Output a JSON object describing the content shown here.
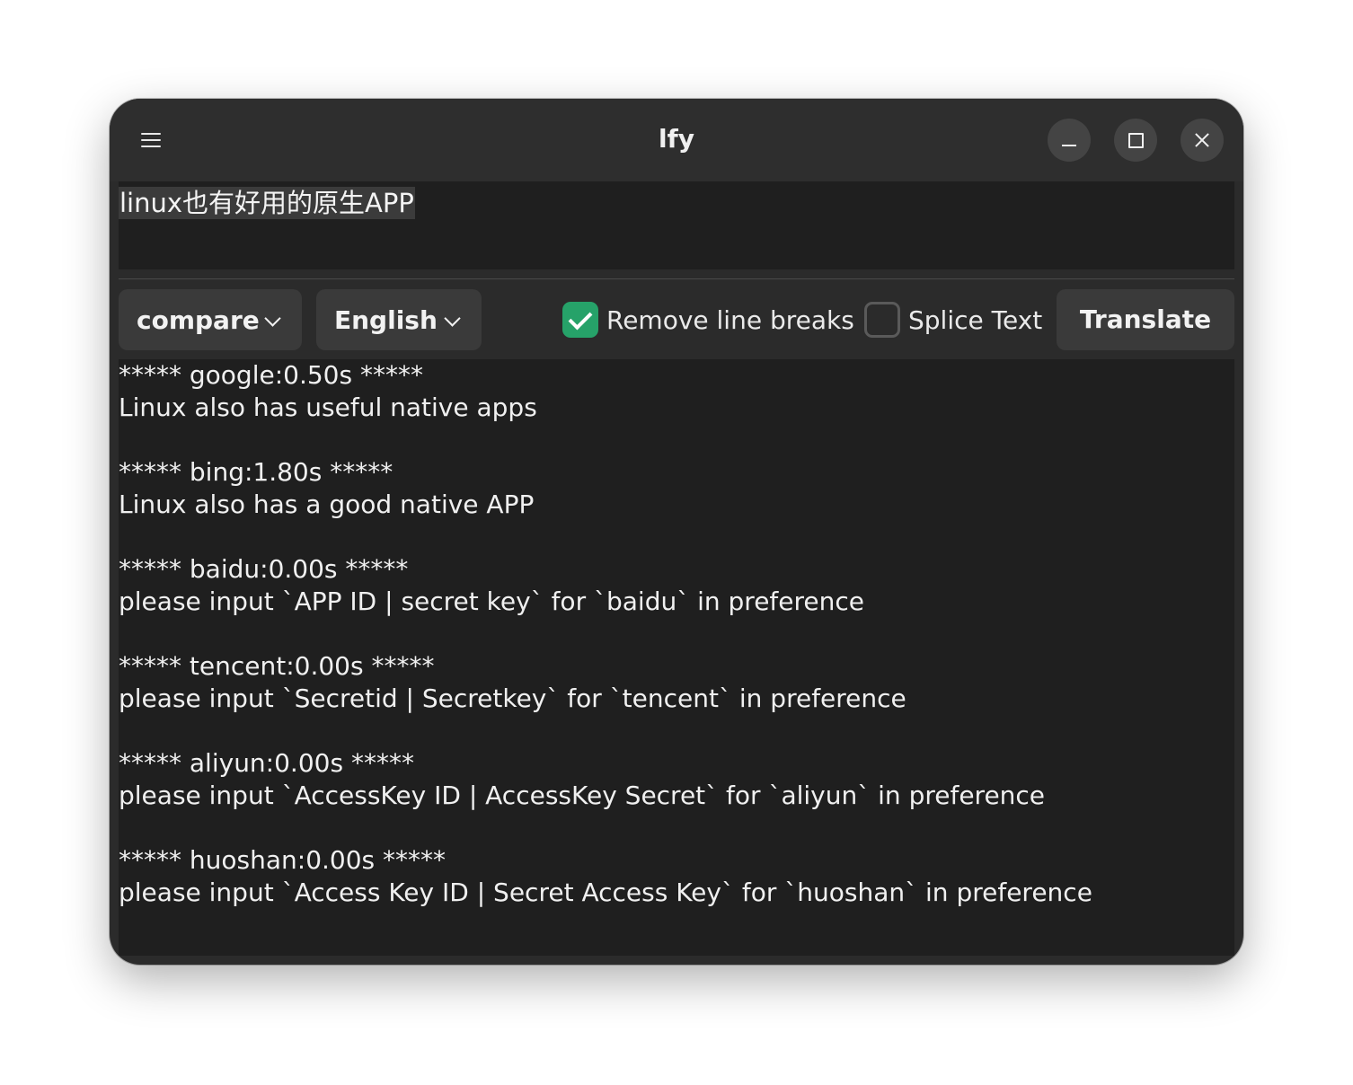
{
  "window": {
    "title": "lfy"
  },
  "source": {
    "text": "linux也有好用的原生APP"
  },
  "toolbar": {
    "mode_dropdown": "compare",
    "language_dropdown": "English",
    "remove_line_breaks": {
      "label": "Remove line breaks",
      "checked": true
    },
    "splice_text": {
      "label": "Splice Text",
      "checked": false
    },
    "translate_label": "Translate"
  },
  "results": [
    {
      "header": "***** google:0.50s *****",
      "text": "Linux also has useful native apps"
    },
    {
      "header": "***** bing:1.80s *****",
      "text": "Linux also has a good native APP"
    },
    {
      "header": "***** baidu:0.00s *****",
      "text": "please input `APP ID | secret key` for `baidu` in preference"
    },
    {
      "header": "***** tencent:0.00s *****",
      "text": "please input `Secretid | Secretkey` for `tencent` in preference"
    },
    {
      "header": "***** aliyun:0.00s *****",
      "text": "please input `AccessKey ID | AccessKey Secret` for `aliyun` in preference"
    },
    {
      "header": "***** huoshan:0.00s *****",
      "text": "please input `Access Key ID | Secret Access Key` for `huoshan` in preference"
    }
  ],
  "colors": {
    "window_bg": "#2b2b2b",
    "text_area_bg": "#1f1f1f",
    "button_bg": "#3a3a3a",
    "checkbox_accent": "#26a269"
  }
}
